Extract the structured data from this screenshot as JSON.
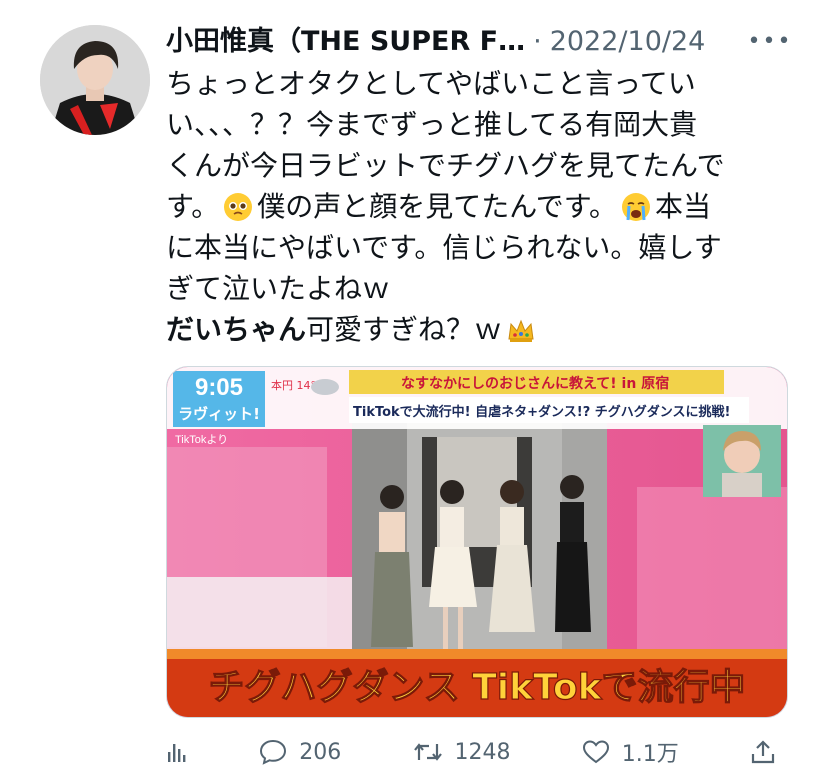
{
  "tweet": {
    "author_name": "小田惟真（THE SUPER F…",
    "separator": "·",
    "date": "2022/10/24",
    "more_label": "•••",
    "body_lines": [
      "ちょっとオタクとしてやばいこと言ってい",
      "い、、、？？今までずっと推してる有岡大貴",
      "くんが今日ラビットでチグハグを見てたんで",
      [
        "す。",
        "僕の声と顔を見てたんです。",
        "本当"
      ],
      "に本当にやばいです。信じられない。嬉しす",
      "ぎて泣いたよねｗ",
      [
        "だいちゃん",
        "可愛すぎね？ｗ"
      ]
    ],
    "emojis": [
      "pleading-face-emoji",
      "crying-face-emoji",
      "crown-emoji"
    ]
  },
  "media": {
    "time_display": "9:05",
    "show_logo": "ラヴィット!",
    "weather_label": "本円 14°",
    "source_tag": "TikTokより",
    "headline": "なすなかにしのおじさんに教えて! in 原宿",
    "ticker": "TikTokで大流行中! 自虐ネタ+ダンス!? チグハグダンスに挑戦!",
    "caption": "チグハグダンス TikTokで流行中"
  },
  "actions": {
    "views_icon": "bar-chart-icon",
    "replies": "206",
    "retweets": "1248",
    "likes": "1.1万",
    "share_icon": "share-icon"
  },
  "colors": {
    "text": "#0f1419",
    "secondary": "#536471",
    "media_pink": "#e85a93"
  }
}
